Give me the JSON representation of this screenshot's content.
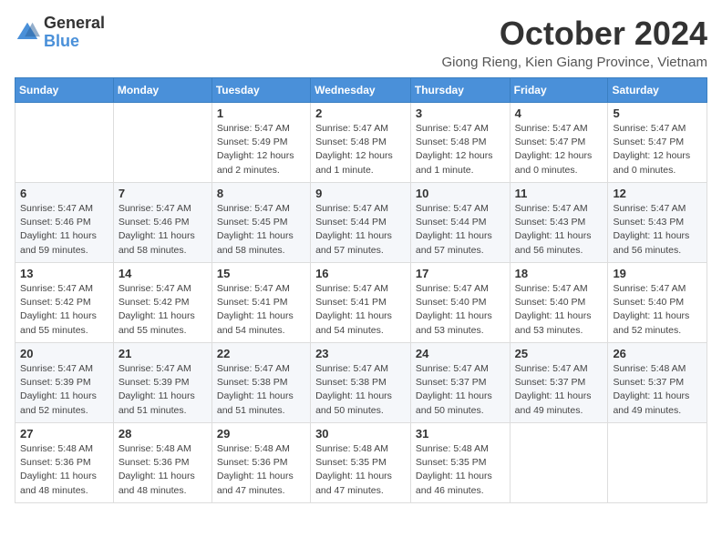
{
  "header": {
    "logo": {
      "general": "General",
      "blue": "Blue"
    },
    "title": "October 2024",
    "subtitle": "Giong Rieng, Kien Giang Province, Vietnam"
  },
  "weekdays": [
    "Sunday",
    "Monday",
    "Tuesday",
    "Wednesday",
    "Thursday",
    "Friday",
    "Saturday"
  ],
  "weeks": [
    [
      {
        "day": "",
        "info": ""
      },
      {
        "day": "",
        "info": ""
      },
      {
        "day": "1",
        "info": "Sunrise: 5:47 AM\nSunset: 5:49 PM\nDaylight: 12 hours\nand 2 minutes."
      },
      {
        "day": "2",
        "info": "Sunrise: 5:47 AM\nSunset: 5:48 PM\nDaylight: 12 hours\nand 1 minute."
      },
      {
        "day": "3",
        "info": "Sunrise: 5:47 AM\nSunset: 5:48 PM\nDaylight: 12 hours\nand 1 minute."
      },
      {
        "day": "4",
        "info": "Sunrise: 5:47 AM\nSunset: 5:47 PM\nDaylight: 12 hours\nand 0 minutes."
      },
      {
        "day": "5",
        "info": "Sunrise: 5:47 AM\nSunset: 5:47 PM\nDaylight: 12 hours\nand 0 minutes."
      }
    ],
    [
      {
        "day": "6",
        "info": "Sunrise: 5:47 AM\nSunset: 5:46 PM\nDaylight: 11 hours\nand 59 minutes."
      },
      {
        "day": "7",
        "info": "Sunrise: 5:47 AM\nSunset: 5:46 PM\nDaylight: 11 hours\nand 58 minutes."
      },
      {
        "day": "8",
        "info": "Sunrise: 5:47 AM\nSunset: 5:45 PM\nDaylight: 11 hours\nand 58 minutes."
      },
      {
        "day": "9",
        "info": "Sunrise: 5:47 AM\nSunset: 5:44 PM\nDaylight: 11 hours\nand 57 minutes."
      },
      {
        "day": "10",
        "info": "Sunrise: 5:47 AM\nSunset: 5:44 PM\nDaylight: 11 hours\nand 57 minutes."
      },
      {
        "day": "11",
        "info": "Sunrise: 5:47 AM\nSunset: 5:43 PM\nDaylight: 11 hours\nand 56 minutes."
      },
      {
        "day": "12",
        "info": "Sunrise: 5:47 AM\nSunset: 5:43 PM\nDaylight: 11 hours\nand 56 minutes."
      }
    ],
    [
      {
        "day": "13",
        "info": "Sunrise: 5:47 AM\nSunset: 5:42 PM\nDaylight: 11 hours\nand 55 minutes."
      },
      {
        "day": "14",
        "info": "Sunrise: 5:47 AM\nSunset: 5:42 PM\nDaylight: 11 hours\nand 55 minutes."
      },
      {
        "day": "15",
        "info": "Sunrise: 5:47 AM\nSunset: 5:41 PM\nDaylight: 11 hours\nand 54 minutes."
      },
      {
        "day": "16",
        "info": "Sunrise: 5:47 AM\nSunset: 5:41 PM\nDaylight: 11 hours\nand 54 minutes."
      },
      {
        "day": "17",
        "info": "Sunrise: 5:47 AM\nSunset: 5:40 PM\nDaylight: 11 hours\nand 53 minutes."
      },
      {
        "day": "18",
        "info": "Sunrise: 5:47 AM\nSunset: 5:40 PM\nDaylight: 11 hours\nand 53 minutes."
      },
      {
        "day": "19",
        "info": "Sunrise: 5:47 AM\nSunset: 5:40 PM\nDaylight: 11 hours\nand 52 minutes."
      }
    ],
    [
      {
        "day": "20",
        "info": "Sunrise: 5:47 AM\nSunset: 5:39 PM\nDaylight: 11 hours\nand 52 minutes."
      },
      {
        "day": "21",
        "info": "Sunrise: 5:47 AM\nSunset: 5:39 PM\nDaylight: 11 hours\nand 51 minutes."
      },
      {
        "day": "22",
        "info": "Sunrise: 5:47 AM\nSunset: 5:38 PM\nDaylight: 11 hours\nand 51 minutes."
      },
      {
        "day": "23",
        "info": "Sunrise: 5:47 AM\nSunset: 5:38 PM\nDaylight: 11 hours\nand 50 minutes."
      },
      {
        "day": "24",
        "info": "Sunrise: 5:47 AM\nSunset: 5:37 PM\nDaylight: 11 hours\nand 50 minutes."
      },
      {
        "day": "25",
        "info": "Sunrise: 5:47 AM\nSunset: 5:37 PM\nDaylight: 11 hours\nand 49 minutes."
      },
      {
        "day": "26",
        "info": "Sunrise: 5:48 AM\nSunset: 5:37 PM\nDaylight: 11 hours\nand 49 minutes."
      }
    ],
    [
      {
        "day": "27",
        "info": "Sunrise: 5:48 AM\nSunset: 5:36 PM\nDaylight: 11 hours\nand 48 minutes."
      },
      {
        "day": "28",
        "info": "Sunrise: 5:48 AM\nSunset: 5:36 PM\nDaylight: 11 hours\nand 48 minutes."
      },
      {
        "day": "29",
        "info": "Sunrise: 5:48 AM\nSunset: 5:36 PM\nDaylight: 11 hours\nand 47 minutes."
      },
      {
        "day": "30",
        "info": "Sunrise: 5:48 AM\nSunset: 5:35 PM\nDaylight: 11 hours\nand 47 minutes."
      },
      {
        "day": "31",
        "info": "Sunrise: 5:48 AM\nSunset: 5:35 PM\nDaylight: 11 hours\nand 46 minutes."
      },
      {
        "day": "",
        "info": ""
      },
      {
        "day": "",
        "info": ""
      }
    ]
  ]
}
